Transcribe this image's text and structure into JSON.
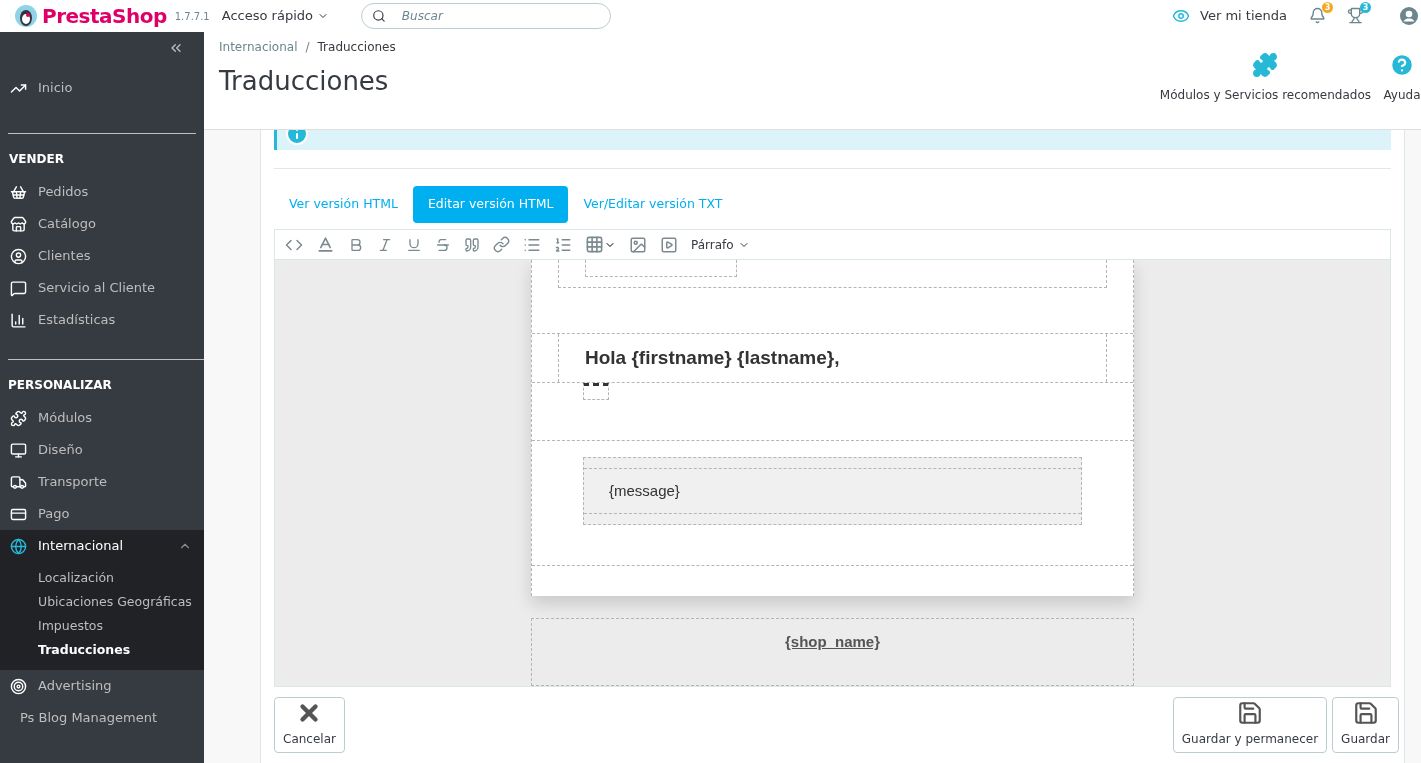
{
  "header": {
    "logo": "PrestaShop",
    "version": "1.7.7.1",
    "quick_access": "Acceso rápido",
    "search": {
      "placeholder": "Buscar"
    },
    "view_store": "Ver mi tienda",
    "notifications": [
      {
        "kind": "bell",
        "count": "3",
        "color": "#f5a623"
      },
      {
        "kind": "trophy",
        "count": "3",
        "color": "#25b9d7"
      }
    ]
  },
  "sidebar": {
    "top": [
      {
        "kind": "trend",
        "label": "Inicio",
        "selected": false
      }
    ],
    "sections": [
      {
        "title": "VENDER",
        "items": [
          {
            "kind": "basket",
            "label": "Pedidos",
            "selected": false,
            "expanded": false
          },
          {
            "kind": "store",
            "label": "Catálogo",
            "selected": false,
            "expanded": false
          },
          {
            "kind": "user",
            "label": "Clientes",
            "selected": false,
            "expanded": false
          },
          {
            "kind": "chat",
            "label": "Servicio al Cliente",
            "selected": false,
            "expanded": false
          },
          {
            "kind": "stats",
            "label": "Estadísticas",
            "selected": false,
            "expanded": false
          }
        ]
      },
      {
        "title": "PERSONALIZAR",
        "items": [
          {
            "kind": "puzzle",
            "label": "Módulos",
            "selected": false,
            "expanded": false
          },
          {
            "kind": "monitor",
            "label": "Diseño",
            "selected": false,
            "expanded": false
          },
          {
            "kind": "truck",
            "label": "Transporte",
            "selected": false,
            "expanded": false
          },
          {
            "kind": "card",
            "label": "Pago",
            "selected": false,
            "expanded": false
          },
          {
            "kind": "globe",
            "label": "Internacional",
            "selected": true,
            "expanded": true,
            "children": [
              {
                "label": "Localización",
                "selected": false
              },
              {
                "label": "Ubicaciones Geográficas",
                "selected": false
              },
              {
                "label": "Impuestos",
                "selected": false
              },
              {
                "label": "Traducciones",
                "selected": true
              }
            ]
          },
          {
            "kind": "target",
            "label": "Advertising",
            "selected": false,
            "expanded": false
          },
          {
            "kind": "none",
            "label": "Ps Blog Management",
            "selected": false,
            "expanded": false
          }
        ]
      }
    ]
  },
  "breadcrumb": [
    "Internacional",
    "/",
    "Traducciones"
  ],
  "page_title": "Traducciones",
  "toolbar": [
    {
      "kind": "puzzle",
      "label": "Módulos y Servicios recomendados"
    },
    {
      "kind": "help",
      "label": "Ayuda"
    }
  ],
  "tabs": [
    {
      "label": "Ver versión HTML",
      "selected": false
    },
    {
      "label": "Editar versión HTML",
      "selected": true
    },
    {
      "label": "Ver/Editar versión TXT",
      "selected": false
    }
  ],
  "editor": {
    "format": "Párrafo",
    "greeting": "Hola {firstname} {lastname},",
    "message": "{message}",
    "shop_name": "{shop_name}"
  },
  "actions": [
    {
      "kind": "cancel",
      "label": "Cancelar"
    },
    {
      "kind": "save",
      "label": "Guardar y permanecer"
    },
    {
      "kind": "save",
      "label": "Guardar"
    }
  ]
}
